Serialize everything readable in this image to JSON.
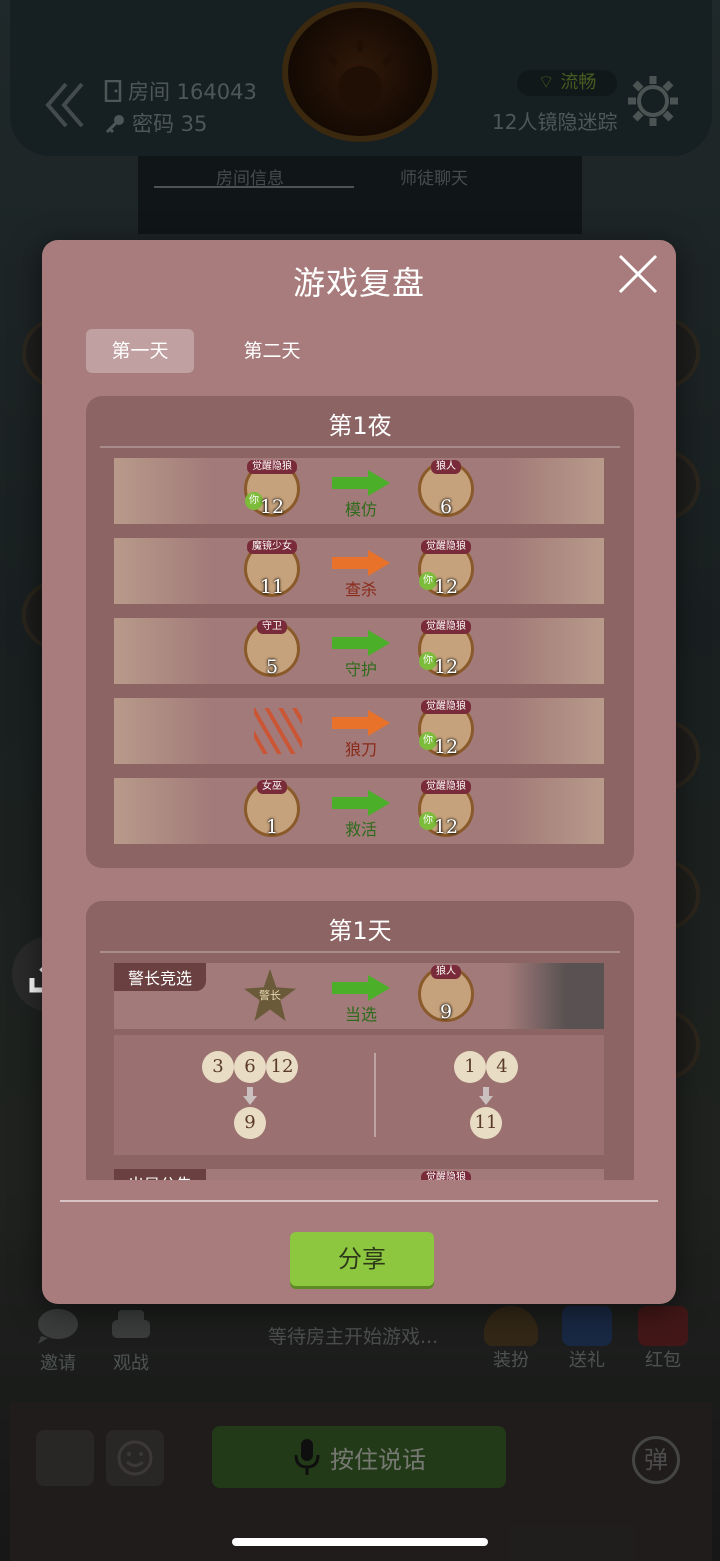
{
  "header": {
    "room_label": "房间 164043",
    "password_label": "密码 35",
    "network_status": "流畅",
    "game_mode": "12人镜隐迷踪"
  },
  "room_tabs": [
    "房间信息",
    "师徒聊天"
  ],
  "modal": {
    "title": "游戏复盘",
    "day_tabs": [
      "第一天",
      "第二天"
    ],
    "active_day": 0,
    "share_label": "分享"
  },
  "night1": {
    "title": "第1夜",
    "actions": [
      {
        "actor_role": "觉醒隐狼",
        "actor_seat": "12",
        "actor_is_you": true,
        "verb": "模仿",
        "arrow_color": "#4caf2a",
        "verb_color": "#2f6b1c",
        "target_role": "狼人",
        "target_seat": "6",
        "target_is_you": false
      },
      {
        "actor_role": "魔镜少女",
        "actor_seat": "11",
        "actor_is_you": false,
        "verb": "查杀",
        "arrow_color": "#e8722a",
        "verb_color": "#8a2a1a",
        "target_role": "觉醒隐狼",
        "target_seat": "12",
        "target_is_you": true
      },
      {
        "actor_role": "守卫",
        "actor_seat": "5",
        "actor_is_you": false,
        "verb": "守护",
        "arrow_color": "#4caf2a",
        "verb_color": "#2f6b1c",
        "target_role": "觉醒隐狼",
        "target_seat": "12",
        "target_is_you": true
      },
      {
        "actor_role": "",
        "actor_seat": "",
        "actor_is_you": false,
        "verb": "狼刀",
        "arrow_color": "#e8722a",
        "verb_color": "#8a2a1a",
        "target_role": "觉醒隐狼",
        "target_seat": "12",
        "target_is_you": true
      },
      {
        "actor_role": "女巫",
        "actor_seat": "1",
        "actor_is_you": false,
        "verb": "救活",
        "arrow_color": "#4caf2a",
        "verb_color": "#2f6b1c",
        "target_role": "觉醒隐狼",
        "target_seat": "12",
        "target_is_you": true
      }
    ]
  },
  "day1": {
    "title": "第1天",
    "sheriff": {
      "tag": "警长竞选",
      "badge_text": "警长",
      "verb": "当选",
      "target_role": "狼人",
      "target_seat": "9"
    },
    "votes": {
      "left_voters": [
        "3",
        "6",
        "12"
      ],
      "left_result": "9",
      "right_voters": [
        "1",
        "4"
      ],
      "right_result": "11"
    },
    "next_tag": "出局公告",
    "next_target_role": "觉醒隐狼"
  },
  "you_label": "你",
  "bottom": {
    "invite_label": "邀请",
    "watch_label": "观战",
    "waiting_text": "等待房主开始游戏...",
    "dress_label": "装扮",
    "gift_label": "送礼",
    "red_packet_label": "红包",
    "talk_label": "按住说话",
    "danmu_label": "弹"
  }
}
